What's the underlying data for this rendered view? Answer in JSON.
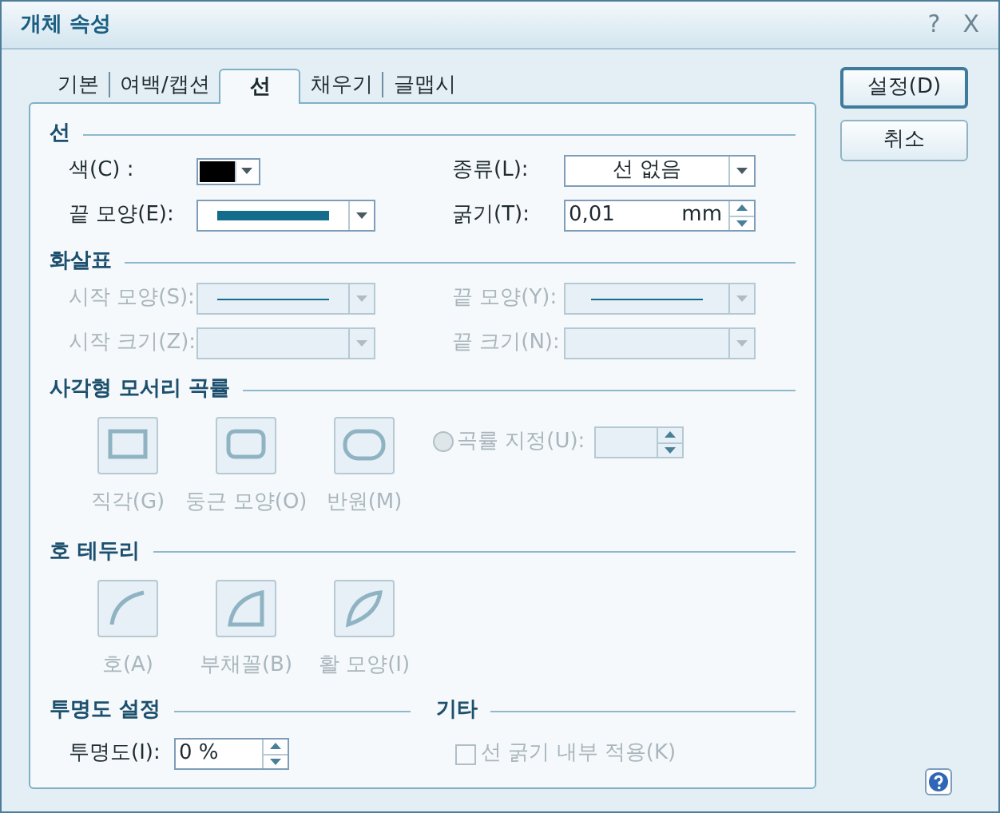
{
  "window": {
    "title": "개체 속성",
    "help_glyph": "?",
    "close_glyph": "X"
  },
  "tabs": [
    {
      "label": "기본",
      "selected": false
    },
    {
      "label": "여백/캡션",
      "selected": false
    },
    {
      "label": "선",
      "selected": true
    },
    {
      "label": "채우기",
      "selected": false
    },
    {
      "label": "글맵시",
      "selected": false
    }
  ],
  "buttons": [
    {
      "label": "설정(D)",
      "default": true
    },
    {
      "label": "취소",
      "default": false
    }
  ],
  "line_section": {
    "title": "선",
    "fields": [
      {
        "kind": "color",
        "label": "색(C) :",
        "color": "#000000",
        "disabled": false
      },
      {
        "kind": "combo",
        "label": "종류(L):",
        "value": "선 없음",
        "disabled": false
      },
      {
        "kind": "thick_line_combo",
        "label": "끝 모양(E):",
        "disabled": false
      },
      {
        "kind": "spin",
        "label": "굵기(T):",
        "value": "0,01",
        "unit": "mm",
        "disabled": false
      }
    ]
  },
  "arrow_section": {
    "title": "화살표",
    "fields": [
      {
        "kind": "thin_line_combo",
        "label": "시작 모양(S):",
        "disabled": true
      },
      {
        "kind": "thin_line_combo",
        "label": "끝 모양(Y):",
        "disabled": true
      },
      {
        "kind": "combo",
        "label": "시작 크기(Z):",
        "disabled": true
      },
      {
        "kind": "combo",
        "label": "끝 크기(N):",
        "disabled": true
      }
    ]
  },
  "corner_section": {
    "title": "사각형 모서리 곡률",
    "disabled": true,
    "shapes": [
      {
        "kind": "rect",
        "label": "직각(G)"
      },
      {
        "kind": "rounded",
        "label": "둥근 모양(O)"
      },
      {
        "kind": "pill",
        "label": "반원(M)"
      }
    ],
    "radio": {
      "label": "곡률 지정(U):",
      "selected": false
    }
  },
  "arc_section": {
    "title": "호 테두리",
    "disabled": true,
    "shapes": [
      {
        "kind": "arc",
        "label": "호(A)"
      },
      {
        "kind": "sector",
        "label": "부채꼴(B)"
      },
      {
        "kind": "bow",
        "label": "활 모양(I)"
      }
    ]
  },
  "transparency_section": {
    "title": "투명도 설정",
    "label": "투명도(I):",
    "value": "0 %"
  },
  "other_section": {
    "title": "기타",
    "checkbox": {
      "label": "선 굵기 내부 적용(K)",
      "checked": false,
      "disabled": true
    }
  }
}
